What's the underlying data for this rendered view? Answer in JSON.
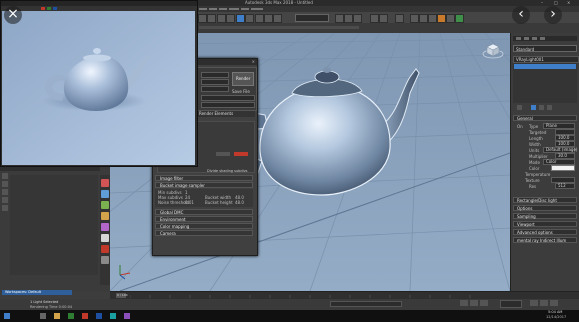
{
  "colors": {
    "viewport_bg": "#8aa2bc",
    "render_bg": "#aac0da",
    "panel_bg": "#3c3c3c",
    "accent_blue": "#3f7fc9",
    "accent_red": "#c0392b"
  },
  "icons": {
    "close": "close-icon",
    "prev": "chevron-left-icon",
    "next": "chevron-right-icon",
    "viewcube": "viewcube-icon",
    "axis": "axis-tripod-icon",
    "teapot": "teapot-icon"
  },
  "main_window": {
    "title": "Autodesk 3ds Max 2018 - Untitled"
  },
  "viewport": {
    "label": "[+] [Perspective] [User Defined] [Default Shading]",
    "object_name": "Teapot001"
  },
  "render_dialog": {
    "buttons": {
      "render": "Render"
    },
    "side_text": {
      "save_file": "Save File",
      "render_elements": "Render Elements"
    },
    "mid_text": {
      "min_subdivs": "Min subdivs",
      "max_subdivs": "Max subdivs",
      "noise_threshold": "Noise threshold",
      "bucket_width": "Bucket width",
      "bucket_height": "Bucket height",
      "divide_shading": "Divide shading subdivs",
      "v_min": "1",
      "v_max": "24",
      "v_noise": "0.01",
      "v_bw": "48.0",
      "v_bh": "48.0"
    },
    "sections": [
      "Image filter",
      "Bucket image sampler",
      "Global DMC",
      "Environment",
      "Color mapping",
      "Camera"
    ]
  },
  "command_panel": {
    "dropdown_top": "Standard",
    "object_name": "VRayLight001",
    "rollouts": {
      "general": "General",
      "rect_disc": "Rectangle/Disc light",
      "options": "Options",
      "sampling": "Sampling",
      "viewport": "Viewport",
      "advanced": "Advanced options",
      "mental_ray": "mental ray Indirect Illum"
    },
    "fields": {
      "on": "On",
      "type": "Type",
      "type_value": "Plane",
      "targeted": "Targeted",
      "length": "Length",
      "length_value": "100.0",
      "width": "Width",
      "width_value": "100.0",
      "units": "Units",
      "units_value": "Default (image)",
      "multiplier": "Multiplier",
      "multiplier_value": "30.0",
      "mode": "Mode",
      "mode_value": "Color",
      "color": "Color",
      "temperature": "Temperature",
      "texture": "Texture",
      "res": "Res",
      "res_value": "512"
    }
  },
  "status": {
    "selection": "1 Light Selected",
    "rendering_time": "Rendering Time  0:00:04",
    "workspace": "Workspaces: Default"
  },
  "timeline": {
    "frame": "0 / 100"
  },
  "taskbar": {
    "clock": "5:04 AM",
    "date": "12/14/2017"
  }
}
